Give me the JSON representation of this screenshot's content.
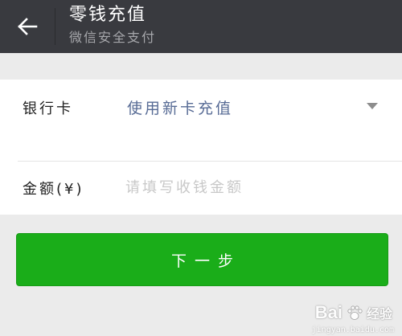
{
  "header": {
    "title": "零钱充值",
    "subtitle": "微信安全支付",
    "back_icon": "arrow-left-icon",
    "background": "#393a3f"
  },
  "form": {
    "bank_card": {
      "label": "银行卡",
      "value": "使用新卡充值",
      "value_color": "#576b95",
      "dropdown_icon": "caret-down-icon"
    },
    "amount": {
      "label": "金额(¥)",
      "placeholder": "请填写收钱金额",
      "value": ""
    }
  },
  "actions": {
    "next_label": "下一步",
    "next_color": "#1aad19"
  },
  "watermark": {
    "brand": "Bai",
    "brand_suffix": "经验",
    "url": "jingyan.baidu.com"
  }
}
